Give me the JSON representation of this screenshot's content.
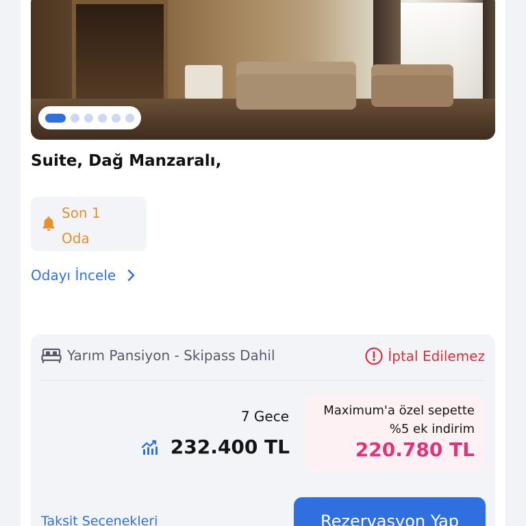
{
  "gallery": {
    "image_alt": "Room photo",
    "dot_count": 6,
    "active_index": 0
  },
  "room": {
    "title": "Suite, Dağ Manzaralı,",
    "availability_line1": "Son 1",
    "availability_line2": "Oda",
    "review_link": "Odayı İncele"
  },
  "offer": {
    "board_type": "Yarım Pansiyon - Skipass Dahil",
    "cancellation": "İptal Edilemez",
    "nights": "7 Gece",
    "price": "232.400 TL",
    "promo_text": "Maximum'a özel sepette %5 ek indirim",
    "promo_price": "220.780 TL",
    "installment_link": "Taksit Seçenekleri",
    "book_button": "Rezervasyon Yap"
  },
  "colors": {
    "accent": "#2f6fe0",
    "warning": "#e4902e",
    "danger": "#d92d3a",
    "promo": "#e3327a"
  },
  "icons": [
    "bell-icon",
    "chevron-right-icon",
    "bed-icon",
    "alert-circle-icon",
    "price-trend-icon"
  ]
}
